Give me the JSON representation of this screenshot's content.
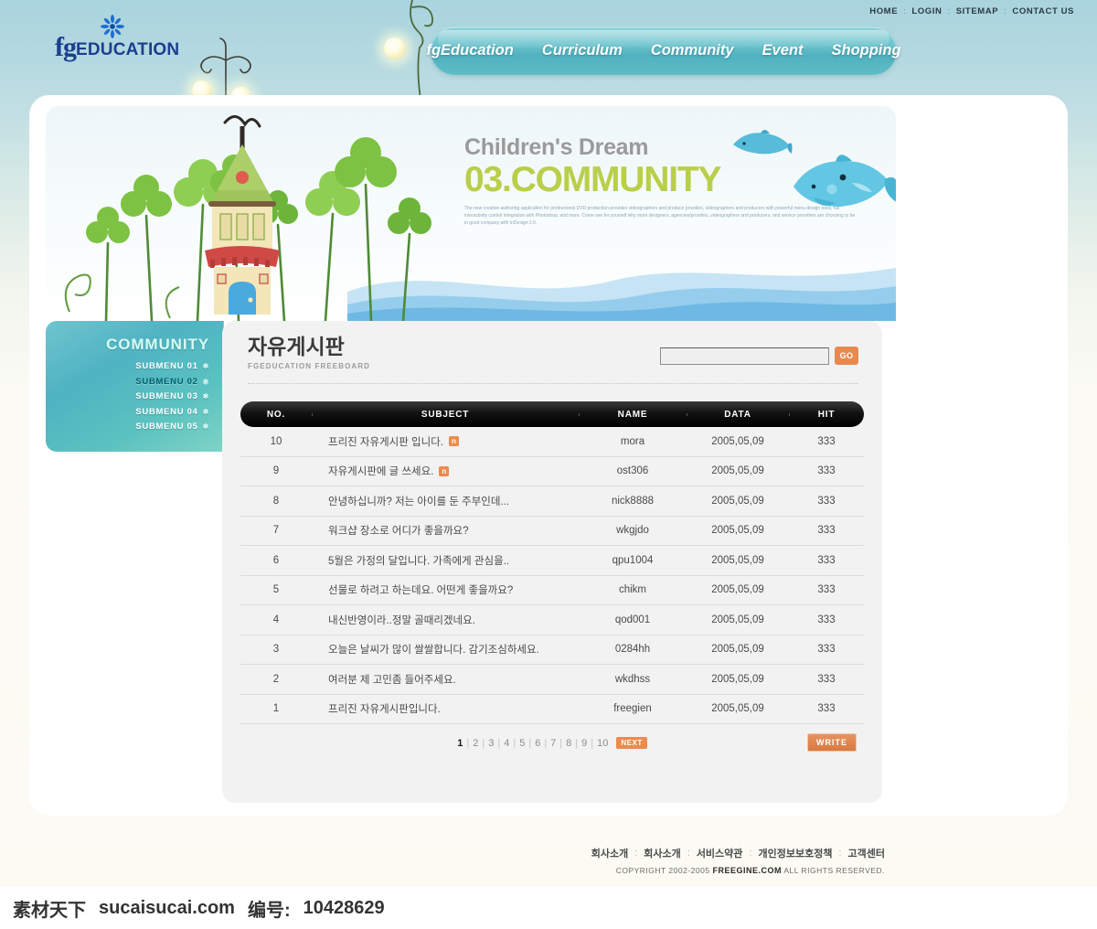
{
  "topnav": {
    "items": [
      {
        "label": "HOME"
      },
      {
        "label": "LOGIN"
      },
      {
        "label": "SITEMAP"
      },
      {
        "label": "CONTACT US"
      }
    ],
    "separator": ":"
  },
  "logo": {
    "fg": "fg",
    "education": "EDUCATION",
    "icon": "flower-icon"
  },
  "mainnav": {
    "items": [
      {
        "label": "fgEducation"
      },
      {
        "label": "Curriculum"
      },
      {
        "label": "Community"
      },
      {
        "label": "Event"
      },
      {
        "label": "Shopping"
      }
    ],
    "bg_color": "#69c0cb"
  },
  "banner": {
    "line1": "Children's Dream",
    "line2": "03.COMMUNITY",
    "body": "The new creative authoring application for professional DVD production provides videographers and produce provides, videographers and producers with powerful menu design tools, full interactivity control integration with Photoshop, and more. Come see for yourself why more designers, agencies/provides, videographers and producers, and service providers are choosing to be in good company with InDesign 2.0.",
    "title_color": "#9a9a9a",
    "accent_color": "#b8cf4a"
  },
  "sidebar": {
    "title": "COMMUNITY",
    "items": [
      {
        "label": "SUBMENU 01",
        "active": false
      },
      {
        "label": "SUBMENU 02",
        "active": true
      },
      {
        "label": "SUBMENU 03",
        "active": false
      },
      {
        "label": "SUBMENU 04",
        "active": false
      },
      {
        "label": "SUBMENU 05",
        "active": false
      }
    ]
  },
  "page": {
    "title_kr": "자유게시판",
    "title_en": "FGEDUCATION FREEBOARD"
  },
  "search": {
    "value": "",
    "placeholder": "",
    "button_label": "GO",
    "button_color": "#e8894f"
  },
  "table": {
    "headers": {
      "no": "NO.",
      "subject": "SUBJECT",
      "name": "NAME",
      "data": "DATA",
      "hit": "HIT"
    },
    "rows": [
      {
        "no": "10",
        "subject": "프리진 자유게시판 입니다.",
        "badge": "n",
        "name": "mora",
        "date": "2005,05,09",
        "hit": "333"
      },
      {
        "no": "9",
        "subject": "자유게시판에 글 쓰세요.",
        "badge": "n",
        "name": "ost306",
        "date": "2005,05,09",
        "hit": "333"
      },
      {
        "no": "8",
        "subject": "안녕하십니까? 저는 아이를 둔 주부인데...",
        "badge": "",
        "name": "nick8888",
        "date": "2005,05,09",
        "hit": "333"
      },
      {
        "no": "7",
        "subject": "워크샵 장소로 어디가 좋을까요?",
        "badge": "",
        "name": "wkgjdo",
        "date": "2005,05,09",
        "hit": "333"
      },
      {
        "no": "6",
        "subject": "5월은 가정의 달입니다. 가족에게 관심을..",
        "badge": "",
        "name": "qpu1004",
        "date": "2005,05,09",
        "hit": "333"
      },
      {
        "no": "5",
        "subject": "선물로 하려고 하는데요. 어떤게 좋을까요?",
        "badge": "",
        "name": "chikm",
        "date": "2005,05,09",
        "hit": "333"
      },
      {
        "no": "4",
        "subject": "내신반영이라..정말 골때리겠네요.",
        "badge": "",
        "name": "qod001",
        "date": "2005,05,09",
        "hit": "333"
      },
      {
        "no": "3",
        "subject": "오늘은 날씨가 많이 쌀쌀합니다. 감기조심하세요.",
        "badge": "",
        "name": "0284hh",
        "date": "2005,05,09",
        "hit": "333"
      },
      {
        "no": "2",
        "subject": "여러분 제 고민좀 들어주세요.",
        "badge": "",
        "name": "wkdhss",
        "date": "2005,05,09",
        "hit": "333"
      },
      {
        "no": "1",
        "subject": "프리진 자유게시판입니다.",
        "badge": "",
        "name": "freegien",
        "date": "2005,05,09",
        "hit": "333"
      }
    ]
  },
  "pagination": {
    "pages": [
      "1",
      "2",
      "3",
      "4",
      "5",
      "6",
      "7",
      "8",
      "9",
      "10"
    ],
    "current": "1",
    "next_label": "NEXT",
    "separator": "|"
  },
  "write": {
    "label": "WRITE"
  },
  "footer": {
    "links": [
      {
        "label": "회사소개"
      },
      {
        "label": "회사소개"
      },
      {
        "label": "서비스약관"
      },
      {
        "label": "개인정보보호정책"
      },
      {
        "label": "고객센터"
      }
    ],
    "separator": ":",
    "copyright_pre": "COPYRIGHT 2002-2005",
    "copyright_brand": "FREEGINE.COM",
    "copyright_post": "ALL RIGHTS RESERVED."
  },
  "watermark": {
    "site_cn": "素材天下",
    "site": "sucaisucai.com",
    "id_label": "编号:",
    "id_value": "10428629"
  }
}
